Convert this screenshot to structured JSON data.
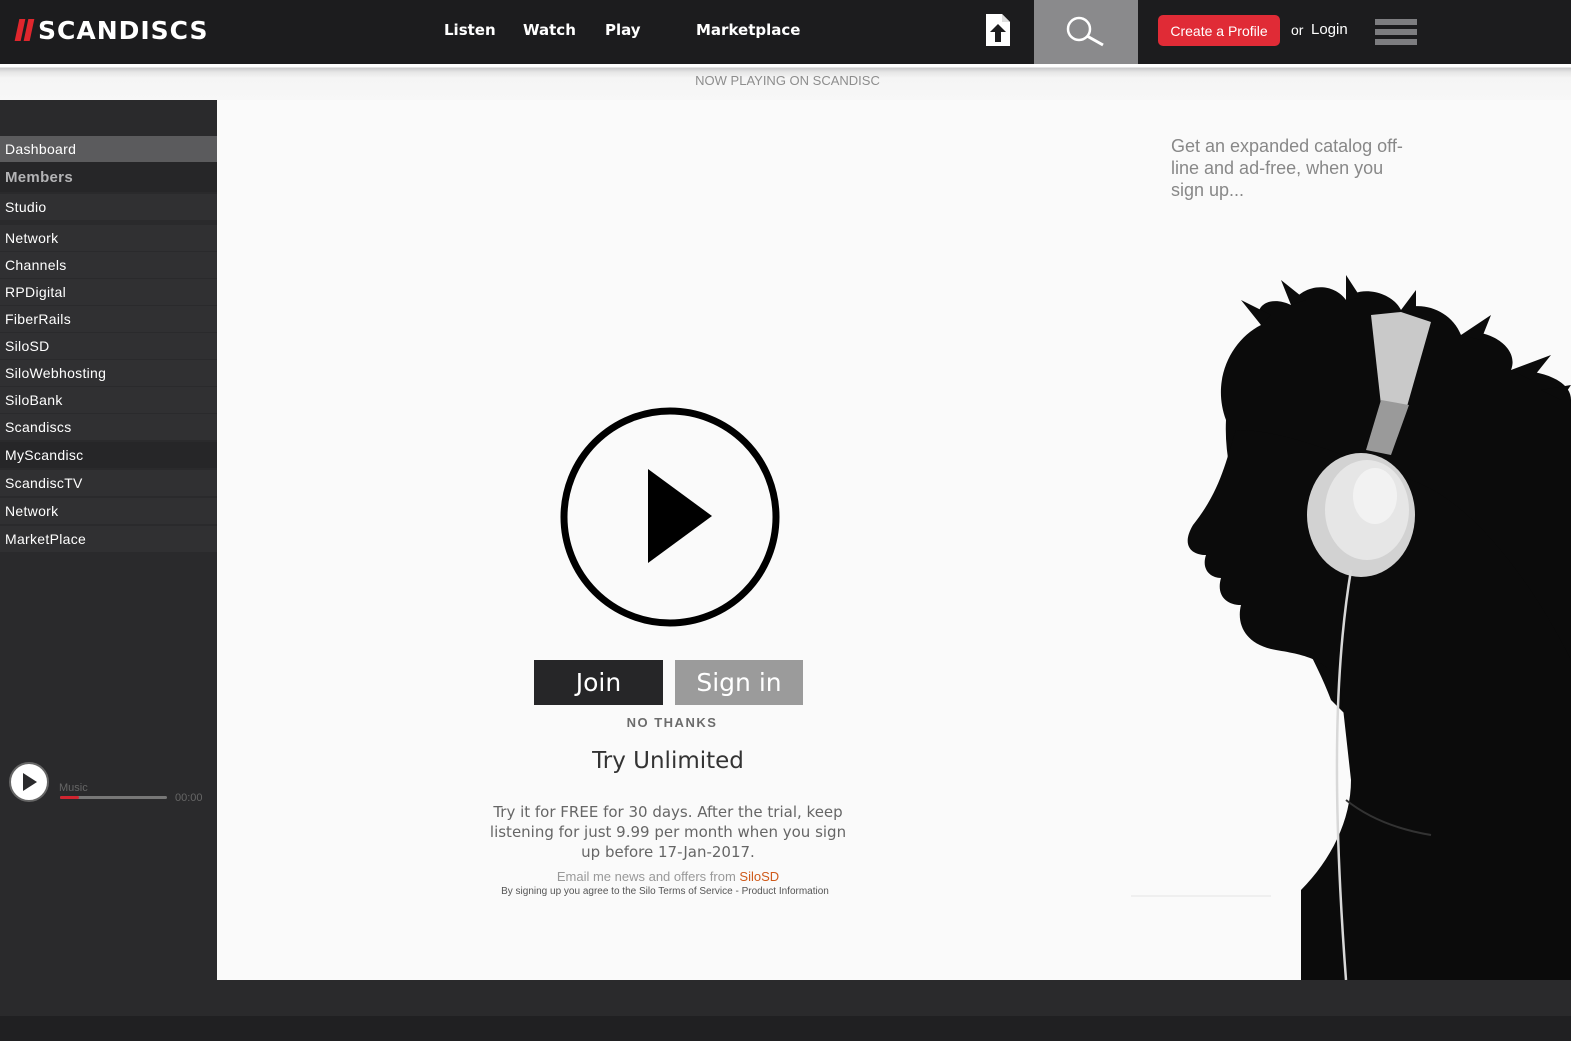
{
  "header": {
    "logo_text": "SCANDISCS",
    "nav": [
      "Listen",
      "Watch",
      "Play",
      "Marketplace"
    ],
    "create_profile": "Create a Profile",
    "or": "or",
    "login": "Login",
    "icons": [
      "upload-icon",
      "search-icon",
      "menu-icon"
    ]
  },
  "now_playing": "NOW PLAYING ON SCANDISC",
  "sidebar": {
    "items": [
      {
        "label": "Dashboard"
      },
      {
        "label": "Members"
      },
      {
        "label": "Studio"
      },
      {
        "label": "Network"
      },
      {
        "label": "Channels"
      },
      {
        "label": "RPDigital"
      },
      {
        "label": "FiberRails"
      },
      {
        "label": "SiloSD"
      },
      {
        "label": "SiloWebhosting"
      },
      {
        "label": "SiloBank"
      },
      {
        "label": "Scandiscs"
      },
      {
        "label": "MyScandisc"
      },
      {
        "label": "ScandiscTV"
      },
      {
        "label": "Network"
      },
      {
        "label": "MarketPlace"
      }
    ],
    "player": {
      "label": "Music",
      "time": "00:00",
      "progress": 0.18
    }
  },
  "main": {
    "join": "Join",
    "sign_in": "Sign in",
    "no_thanks": "NO THANKS",
    "title": "Try Unlimited",
    "description": "Try it for FREE for 30 days.  After the trial, keep listening for just 9.99 per month when you sign up before 17-Jan-2017.",
    "email_prefix": "Email me news and offers from ",
    "email_brand": "SiloSD",
    "terms": "By signing up you agree to the Silo Terms of Service - Product Information"
  },
  "promo": {
    "text": "Get an expanded catalog off-line and ad-free, when you sign up..."
  },
  "colors": {
    "accent_red": "#e02b36",
    "sidebar_bg": "#2a2a2c",
    "topbar_bg": "#1c1c1e",
    "brand_orange": "#cf5a1a"
  }
}
